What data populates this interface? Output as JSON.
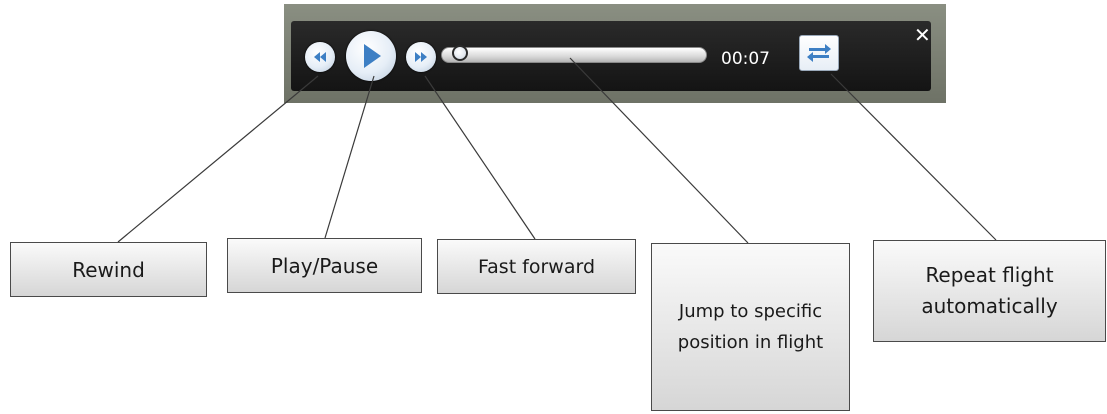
{
  "player": {
    "time": "00:07",
    "close_glyph": "✕",
    "icons": {
      "rewind": "rewind-icon",
      "play": "play-icon",
      "fast_forward": "fast-forward-icon",
      "repeat": "repeat-icon",
      "close": "close-icon"
    },
    "colors": {
      "bar_background": "#1c1c1c",
      "button_glyph": "#3d7fc4",
      "frame": "#7d8276"
    }
  },
  "callouts": {
    "rewind": "Rewind",
    "play_pause": "Play/Pause",
    "fast_forward": "Fast forward",
    "jump": "Jump to specific position in flight",
    "repeat": "Repeat flight automatically"
  }
}
